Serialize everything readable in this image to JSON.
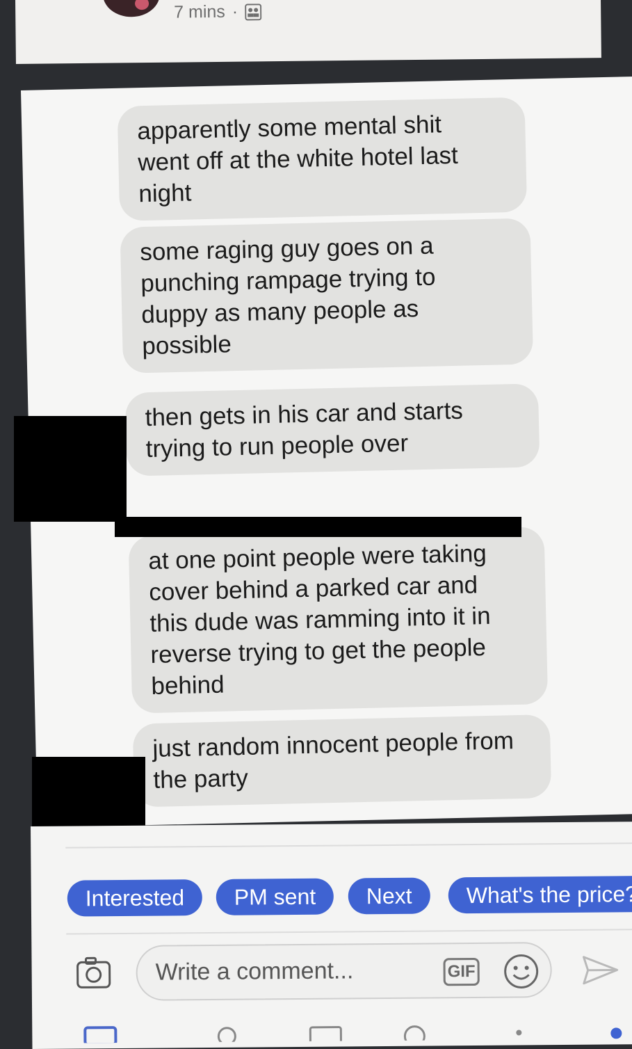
{
  "post": {
    "timestamp": "7 mins",
    "separator": "·",
    "audience_icon": "group-audience-icon"
  },
  "messages": [
    {
      "text": "apparently some mental shit went off at the white hotel last night"
    },
    {
      "text": "some raging guy goes on a punching rampage trying to duppy as many people as possible"
    },
    {
      "text": "then gets in his car and starts trying to run people over"
    },
    {
      "text": "at one point people were taking cover behind a parked car and this dude was ramming into it in reverse trying to get the people behind"
    },
    {
      "text": "just random innocent people from the party"
    }
  ],
  "quick_replies": [
    "Interested",
    "PM sent",
    "Next",
    "What's the price?"
  ],
  "comment": {
    "placeholder": "Write a comment...",
    "gif_label": "GIF",
    "icons": [
      "camera-icon",
      "gif-icon",
      "smile-icon",
      "send-icon"
    ]
  },
  "colors": {
    "background": "#2b2d31",
    "chip": "#3f63d2",
    "bubble": "#e2e2e0",
    "card": "#f4f4f3"
  }
}
